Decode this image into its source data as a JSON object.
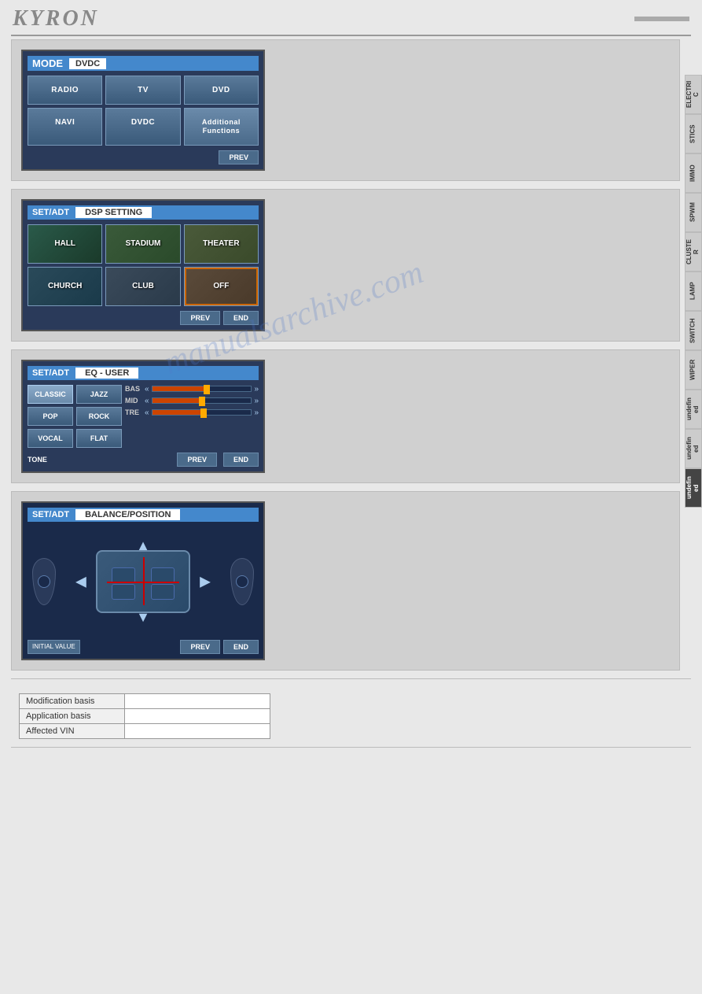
{
  "header": {
    "logo": "KYRON",
    "page_badge": ""
  },
  "sidebar_tabs": [
    {
      "id": "electric",
      "label": "ELECTRI C",
      "active": false
    },
    {
      "id": "stics",
      "label": "STICS",
      "active": false
    },
    {
      "id": "immo",
      "label": "IMMO",
      "active": false
    },
    {
      "id": "spwm",
      "label": "SPWM",
      "active": false
    },
    {
      "id": "cluster",
      "label": "CLUSTE R",
      "active": false
    },
    {
      "id": "lamp",
      "label": "LAMP",
      "active": false
    },
    {
      "id": "switch",
      "label": "SWITCH",
      "active": false
    },
    {
      "id": "wiper",
      "label": "WIPER",
      "active": false
    },
    {
      "id": "undef1",
      "label": "undefin ed",
      "active": false
    },
    {
      "id": "undef2",
      "label": "undefin ed",
      "active": false
    },
    {
      "id": "undef3",
      "label": "undefin ed",
      "active": true
    }
  ],
  "panel1": {
    "mode_label": "MODE",
    "mode_value": "DVDC",
    "buttons": [
      "RADIO",
      "TV",
      "DVD",
      "NAVI",
      "DVDC",
      "Additional Functions"
    ],
    "prev_btn": "PREV"
  },
  "panel2": {
    "setadt_label": "SET/ADT",
    "title": "DSP SETTING",
    "dsp_buttons": [
      "HALL",
      "STADIUM",
      "THEATER",
      "CHURCH",
      "CLUB",
      "OFF"
    ],
    "prev_btn": "PREV",
    "end_btn": "END"
  },
  "panel3": {
    "setadt_label": "SET/ADT",
    "title": "EQ - USER",
    "presets": [
      "CLASSIC",
      "JAZZ",
      "POP",
      "ROCK",
      "VOCAL",
      "FLAT"
    ],
    "sliders": [
      {
        "label": "BAS",
        "value": 55
      },
      {
        "label": "MID",
        "value": 50
      },
      {
        "label": "TRE",
        "value": 52
      }
    ],
    "tone_label": "TONE",
    "prev_btn": "PREV",
    "end_btn": "END"
  },
  "panel4": {
    "setadt_label": "SET/ADT",
    "title": "BALANCE/POSITION",
    "initial_label": "INITIAL VALUE",
    "prev_btn": "PREV",
    "end_btn": "END"
  },
  "watermark": "manualsarchive.com",
  "modification_table": {
    "rows": [
      {
        "label": "Modification basis",
        "value": ""
      },
      {
        "label": "Application basis",
        "value": ""
      },
      {
        "label": "Affected VIN",
        "value": ""
      }
    ]
  }
}
